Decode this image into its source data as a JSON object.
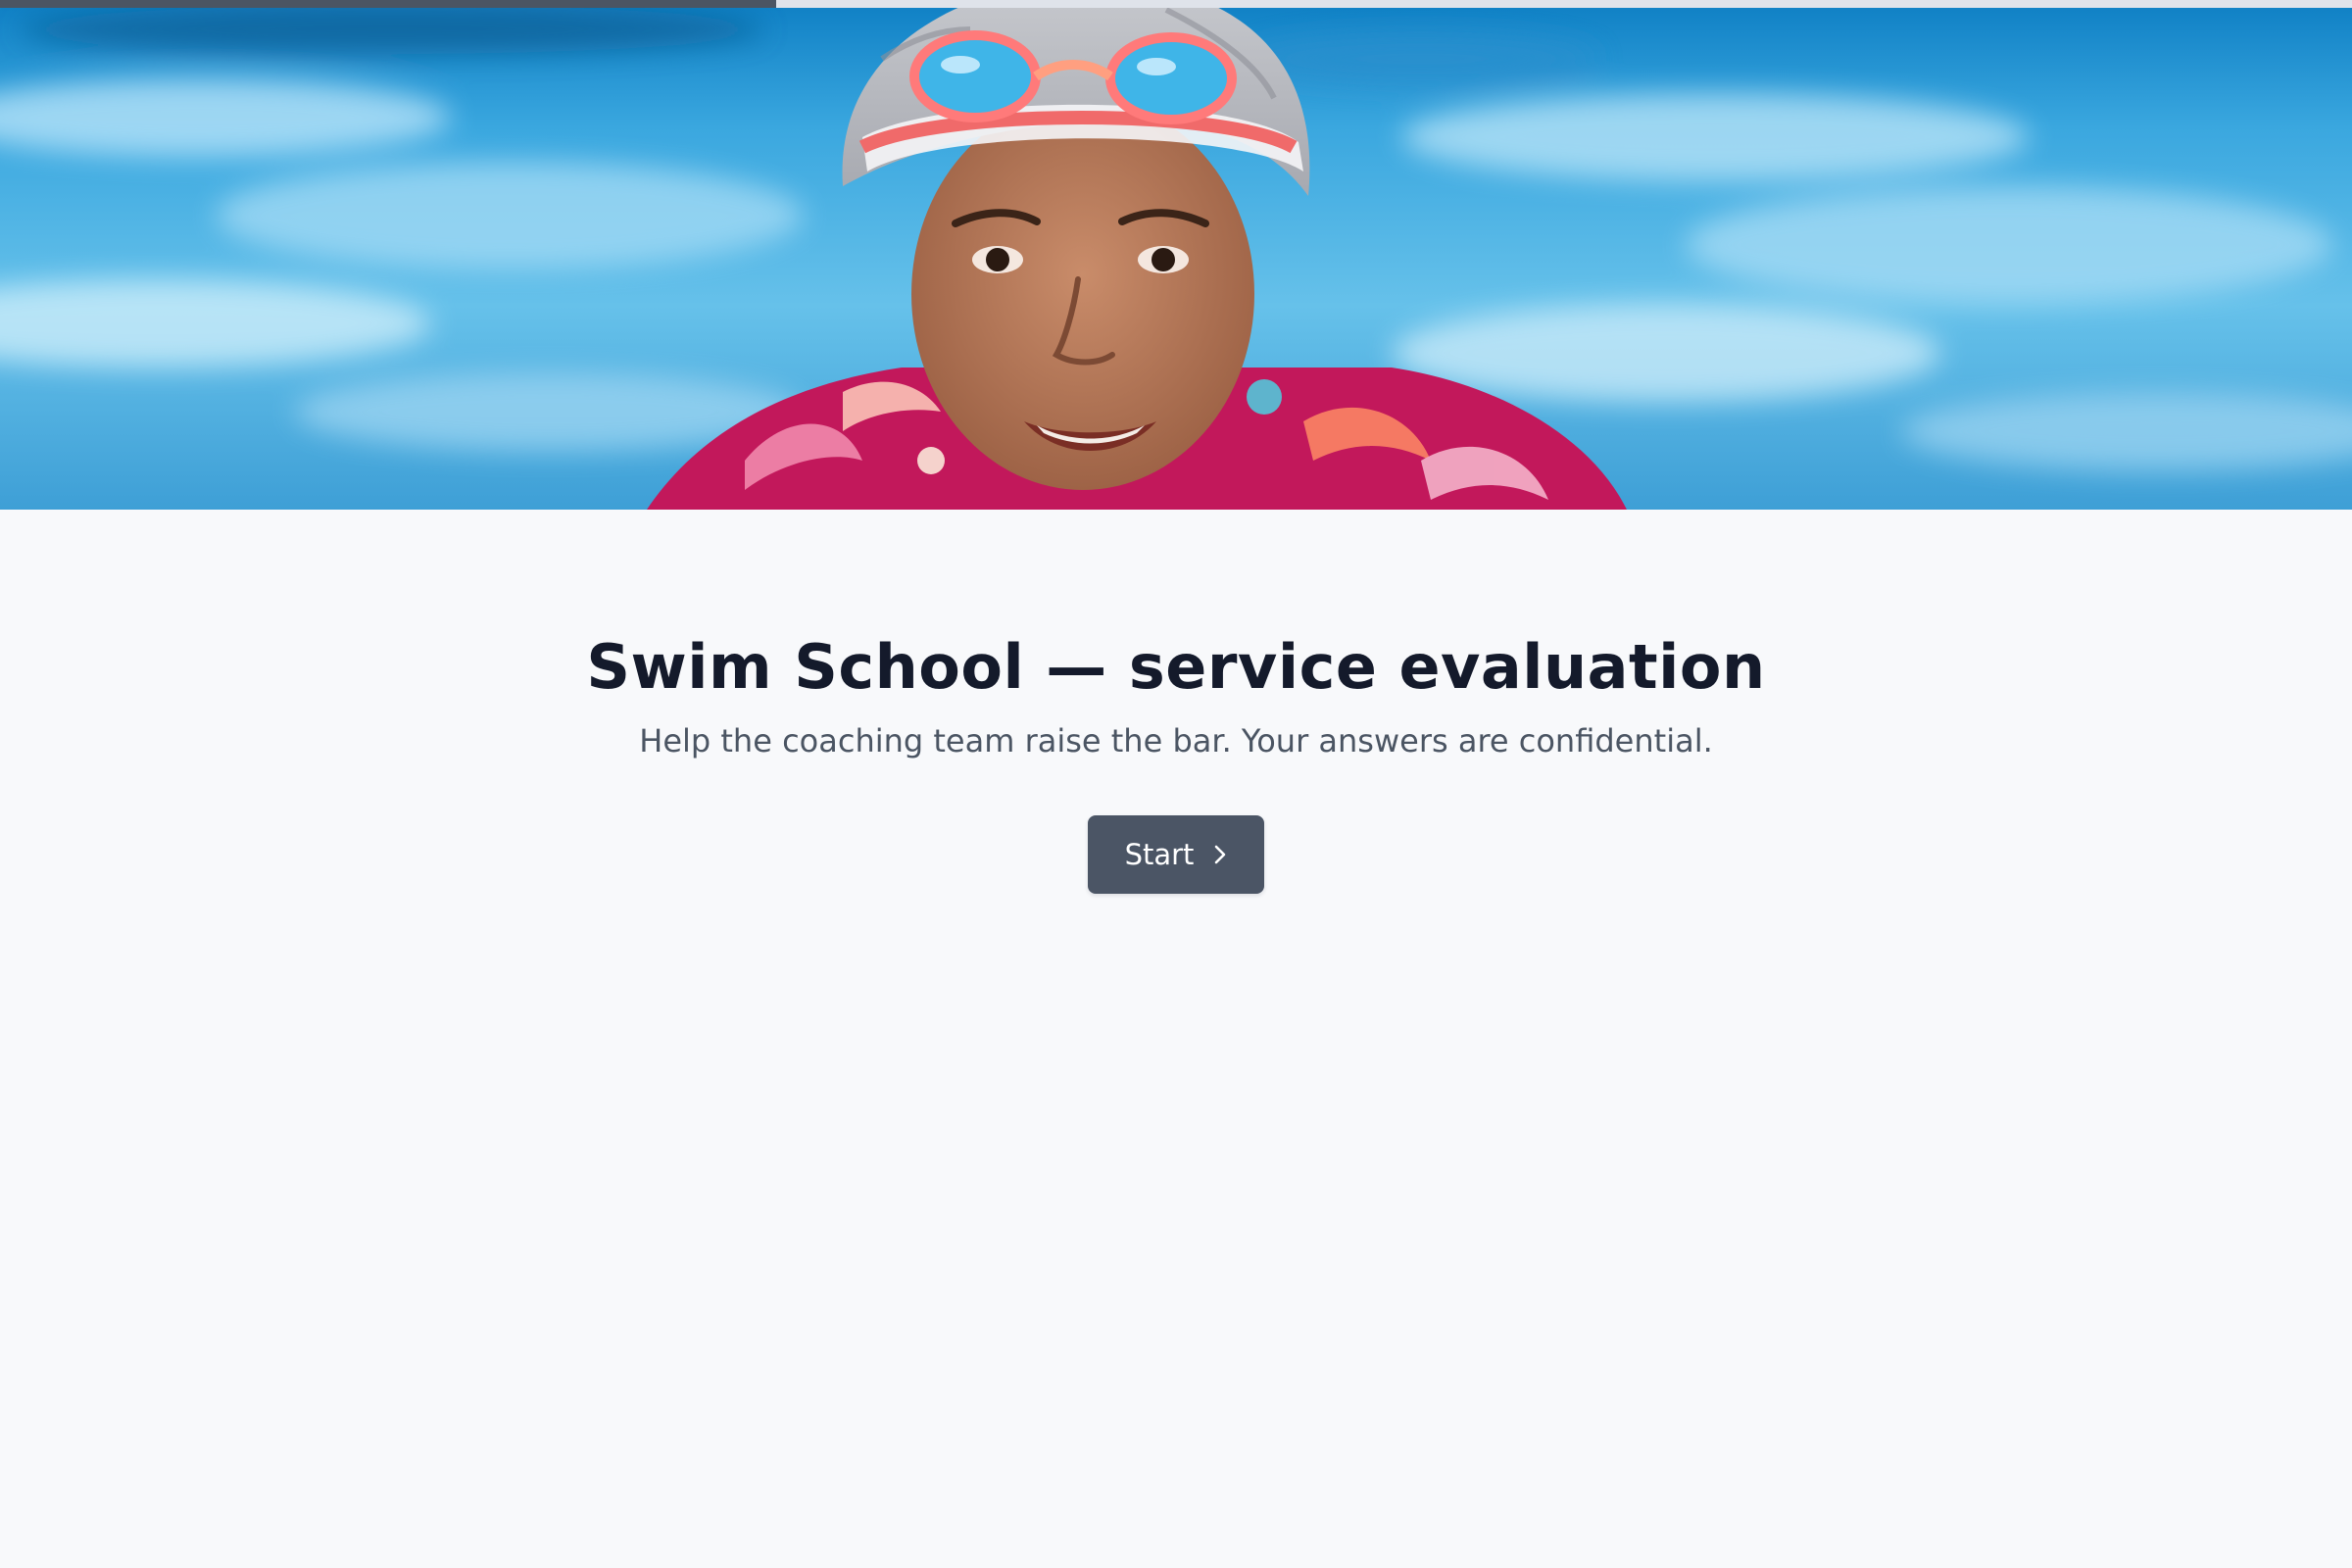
{
  "progress": {
    "value": 0.33,
    "fill_color": "#4b5563",
    "track_color": "#dfe3ea"
  },
  "hero": {
    "image_subject": "child swimmer in pool with swim cap and goggles"
  },
  "survey": {
    "title": "Swim School — service evaluation",
    "subtitle": "Help the coaching team raise the bar. Your answers are confidential.",
    "start_label": "Start",
    "start_icon": "chevron-right-icon"
  },
  "colors": {
    "background": "#f8f9fb",
    "title": "#141a2b",
    "subtitle": "#4b5563",
    "button": "#4b5565",
    "button_text": "#ffffff"
  }
}
